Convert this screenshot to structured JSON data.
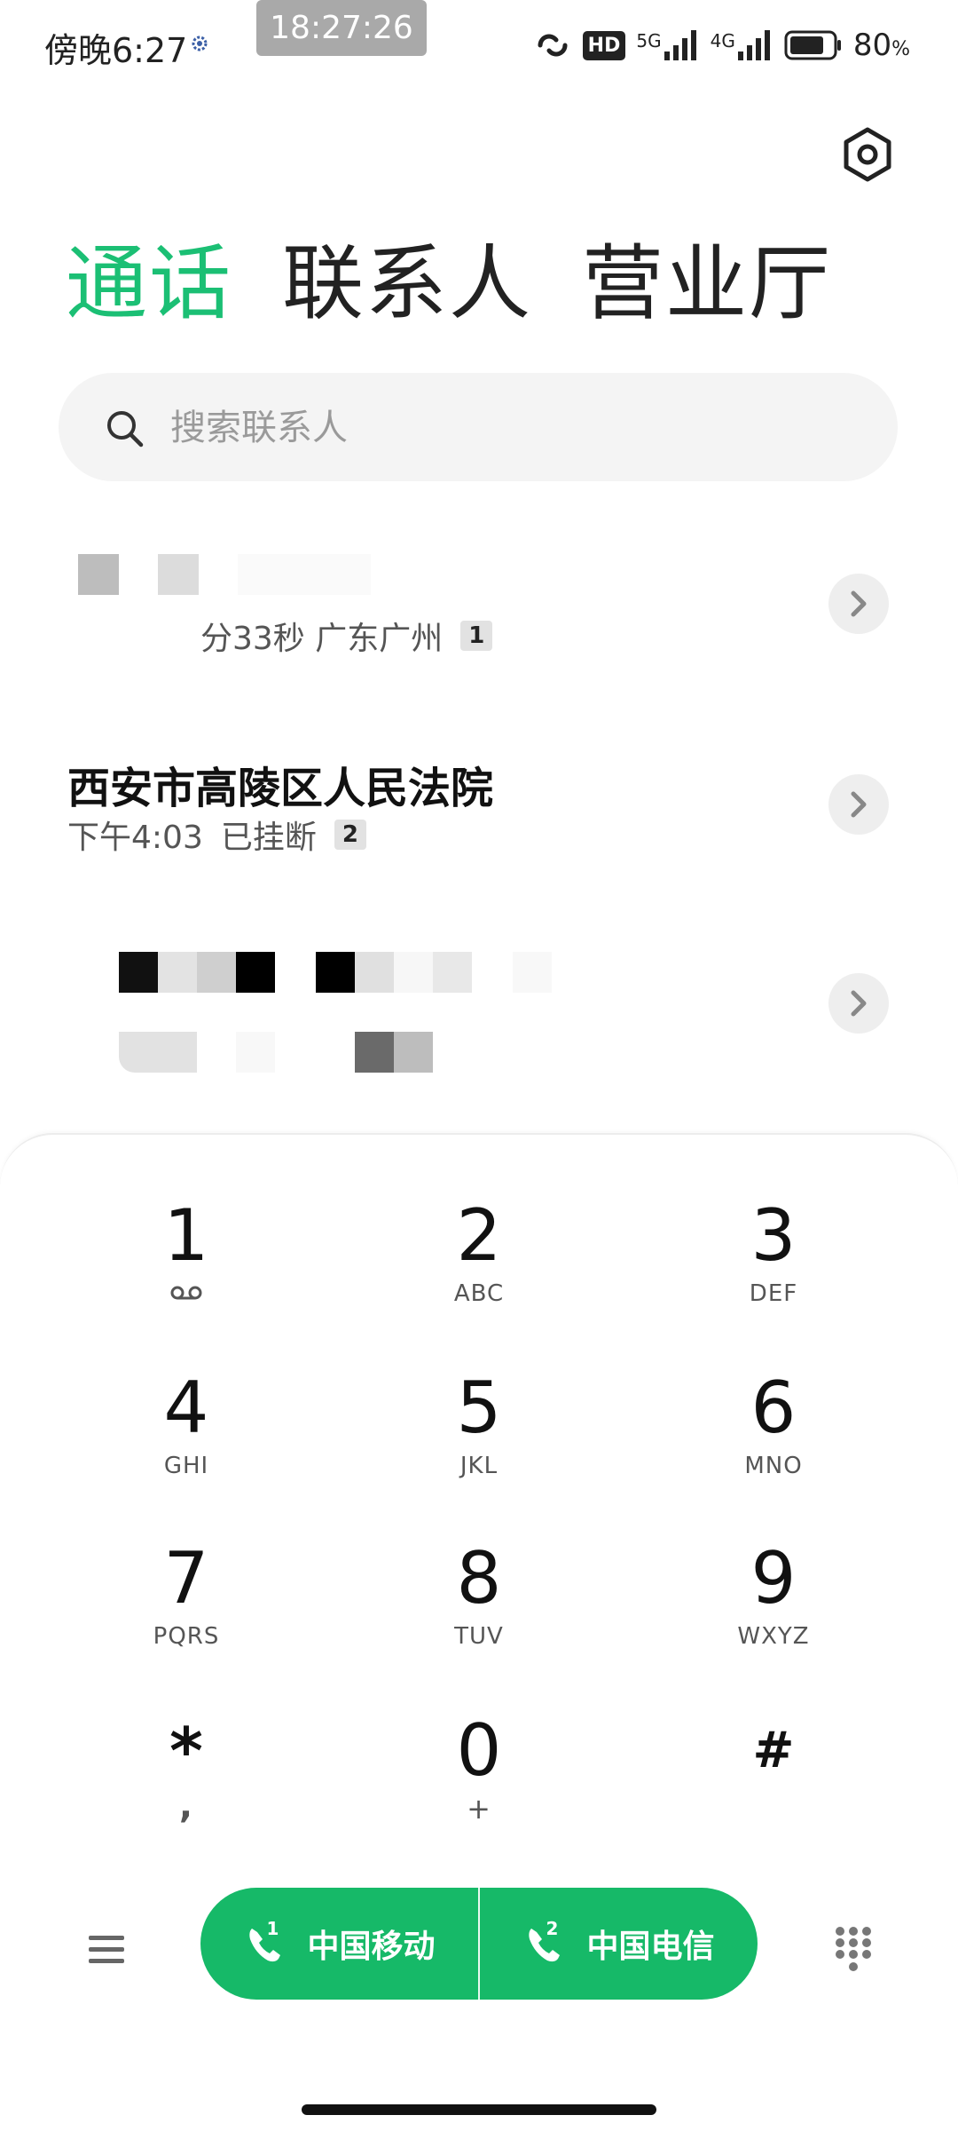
{
  "status_bar": {
    "time": "傍晚6:27",
    "clock": "18:27:26",
    "hd_label": "HD",
    "net_5g": "5G",
    "net_4g": "4G",
    "battery_percent": "80",
    "battery_unit": "%",
    "battery_level": 0.8
  },
  "tabs": [
    {
      "label": "通话",
      "active": true
    },
    {
      "label": "联系人",
      "active": false
    },
    {
      "label": "营业厅",
      "active": false
    }
  ],
  "search": {
    "placeholder": "搜索联系人"
  },
  "calls": [
    {
      "name": "",
      "meta": "分33秒 广东广州",
      "count": "1"
    },
    {
      "name": "西安市高陵区人民法院",
      "time": "下午4:03",
      "status": "已挂断",
      "count": "2"
    },
    {
      "name": "",
      "meta": "",
      "count": ""
    }
  ],
  "dialpad": [
    {
      "digit": "1",
      "letters": ""
    },
    {
      "digit": "2",
      "letters": "ABC"
    },
    {
      "digit": "3",
      "letters": "DEF"
    },
    {
      "digit": "4",
      "letters": "GHI"
    },
    {
      "digit": "5",
      "letters": "JKL"
    },
    {
      "digit": "6",
      "letters": "MNO"
    },
    {
      "digit": "7",
      "letters": "PQRS"
    },
    {
      "digit": "8",
      "letters": "TUV"
    },
    {
      "digit": "9",
      "letters": "WXYZ"
    },
    {
      "digit": "*",
      "letters": ","
    },
    {
      "digit": "0",
      "letters": "+"
    },
    {
      "digit": "#",
      "letters": ""
    }
  ],
  "call_buttons": [
    {
      "sim": "1",
      "label": "中国移动"
    },
    {
      "sim": "2",
      "label": "中国电信"
    }
  ],
  "colors": {
    "accent": "#1bbf74",
    "call_button": "#16b968"
  },
  "icons": [
    "gear-icon",
    "search-icon",
    "chevron-right-icon",
    "voicemail-icon",
    "menu-icon",
    "phone-icon",
    "keypad-icon"
  ]
}
